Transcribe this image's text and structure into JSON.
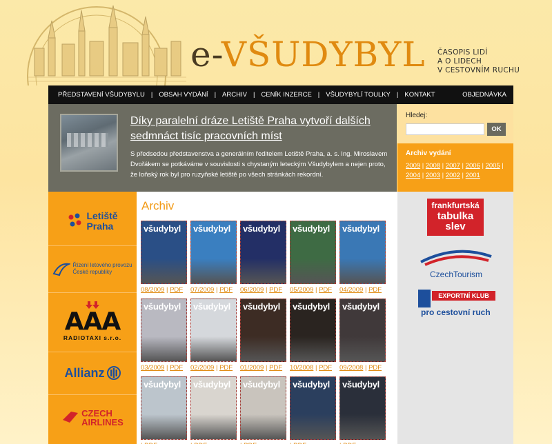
{
  "header": {
    "logo_prefix": "e-",
    "logo_name": "VŠUDYBYL",
    "tagline": [
      "ČASOPIS LIDÍ",
      "A O LIDECH",
      "V CESTOVNÍM RUCHU"
    ]
  },
  "nav": {
    "items": [
      "PŘEDSTAVENÍ VŠUDYBYLU",
      "OBSAH VYDÁNÍ",
      "ARCHIV",
      "CENÍK INZERCE",
      "VŠUDYBYLÍ TOULKY",
      "KONTAKT"
    ],
    "order": "OBJEDNÁVKA"
  },
  "hero": {
    "title": "Díky paralelní dráze Letiště Praha vytvoří dalších sedmnáct tisíc pracovních míst",
    "text": "S předsedou představenstva a generálním ředitelem Letiště Praha, a. s. Ing. Miroslavem Dvořákem se potkáváme v souvislosti s chystaným leteckým Všudybylem a nejen proto, že loňský rok byl pro ruzyňské letiště po všech stránkách rekordní."
  },
  "search": {
    "label": "Hledej:",
    "button": "OK",
    "value": ""
  },
  "archive_box": {
    "title": "Archiv vydání",
    "years": [
      "2009",
      "2008",
      "2007",
      "2006",
      "2005",
      "2004",
      "2003",
      "2002",
      "2001"
    ]
  },
  "left_partners": [
    {
      "name": "Letiště Praha",
      "lines": [
        "Letiště",
        "Praha"
      ]
    },
    {
      "name": "Řízení letového provozu",
      "lines": [
        "Řízení letového provozu",
        "České republiky"
      ]
    },
    {
      "name": "AAA Radiotaxi",
      "lines": [
        "AAA",
        "RADIOTAXI s.r.o."
      ]
    },
    {
      "name": "Allianz",
      "lines": [
        "Allianz"
      ]
    },
    {
      "name": "Czech Airlines",
      "lines": [
        "CZECH",
        "AIRLINES"
      ]
    }
  ],
  "right_partners": [
    {
      "name": "frankfurtská tabulka slev",
      "lines": [
        "frankfurtská",
        "tabulka",
        "slev"
      ]
    },
    {
      "name": "CzechTourism",
      "lines": [
        "CzechTourism"
      ]
    },
    {
      "name": "Exportní klub pro cestovní ruch",
      "lines": [
        "EXPORTNÍ KLUB",
        "pro cestovní ruch"
      ]
    }
  ],
  "main": {
    "title": "Archiv",
    "mast": "všudybyl",
    "pdf": "PDF",
    "covers": [
      {
        "issue": "08/2009",
        "color": "#2a4f86"
      },
      {
        "issue": "07/2009",
        "color": "#3a7fc0"
      },
      {
        "issue": "06/2009",
        "color": "#232f66"
      },
      {
        "issue": "05/2009",
        "color": "#3e6b44"
      },
      {
        "issue": "04/2009",
        "color": "#3a78b5"
      },
      {
        "issue": "03/2009",
        "color": "#b9b9c1"
      },
      {
        "issue": "02/2009",
        "color": "#d5d8dc"
      },
      {
        "issue": "01/2009",
        "color": "#3d2c24"
      },
      {
        "issue": "10/2008",
        "color": "#2a2420"
      },
      {
        "issue": "09/2008",
        "color": "#40393a"
      },
      {
        "issue": "",
        "color": "#bcc5cc"
      },
      {
        "issue": "",
        "color": "#d9d5cf"
      },
      {
        "issue": "",
        "color": "#c9c4bd"
      },
      {
        "issue": "",
        "color": "#2b3f5e"
      },
      {
        "issue": "",
        "color": "#2a2f3a"
      }
    ]
  },
  "colors": {
    "orange": "#f7a017",
    "nav_bg": "#111111",
    "hero_bg": "#6c6c61"
  }
}
